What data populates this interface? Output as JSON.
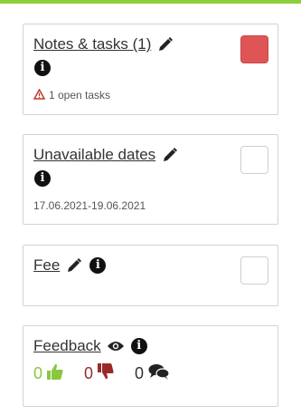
{
  "cards": {
    "notes": {
      "title": "Notes & tasks (1)",
      "warning_text": "1 open tasks",
      "checkbox_color": "#df5555"
    },
    "unavailable": {
      "title": "Unavailable dates",
      "date_range": "17.06.2021-19.06.2021"
    },
    "fee": {
      "title": "Fee"
    },
    "feedback": {
      "title": "Feedback",
      "positive_count": "0",
      "negative_count": "0",
      "comment_count": "0"
    }
  },
  "icons": [
    "pencil-icon",
    "info-icon",
    "warning-icon",
    "eye-icon",
    "thumbs-up-icon",
    "thumbs-down-icon",
    "comments-icon"
  ],
  "colors": {
    "accent_green": "#8fcf3c",
    "positive": "#8cc63f",
    "negative": "#9a2a2a",
    "danger": "#df5555"
  }
}
